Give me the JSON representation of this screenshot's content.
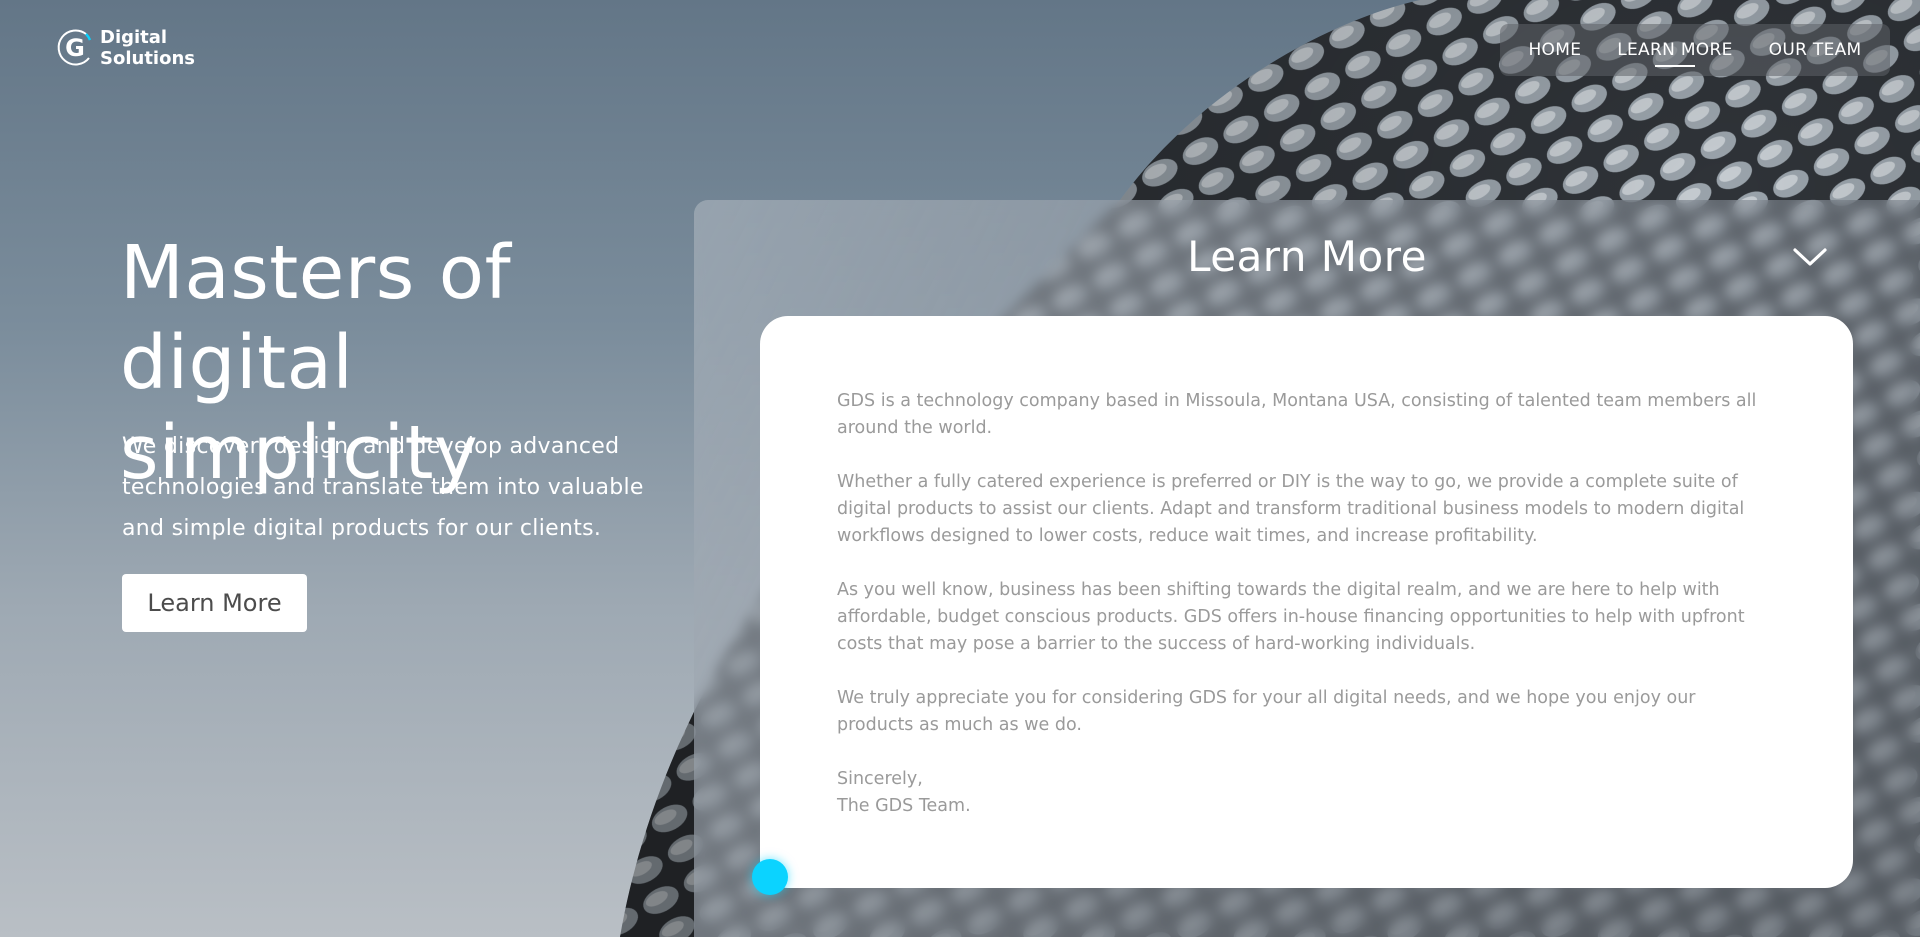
{
  "brand": {
    "logo_letter": "G",
    "line1": "Digital",
    "line2": "Solutions",
    "accent_color": "#0bd3ff"
  },
  "nav": {
    "items": [
      {
        "label": "HOME"
      },
      {
        "label": "LEARN MORE",
        "active": true
      },
      {
        "label": "OUR TEAM"
      }
    ]
  },
  "hero": {
    "title_line1": "Masters of",
    "title_line2": "digital simplicity",
    "subtitle": "We discover, design, and develop advanced technologies and translate them into valuable and simple digital products for our clients.",
    "button_label": "Learn More"
  },
  "panel": {
    "title": "Learn More",
    "toggle_icon": "chevron-down-icon",
    "paragraphs": [
      "GDS is a technology company based in Missoula, Montana USA, consisting of talented team members all around the world.",
      "Whether a fully catered experience is preferred or DIY is the way to go, we provide a complete suite of digital products to assist our clients. Adapt and transform traditional business models to modern digital workflows designed to lower costs, reduce wait times, and increase profitability.",
      "As you well know, business has been shifting towards the digital realm, and we are here to help with affordable, budget conscious products. GDS offers in-house financing opportunities to help with upfront costs that may pose a barrier to the success of hard-working individuals.",
      "We truly appreciate you for considering GDS for your all digital needs, and we hope you enjoy our products as much as we do."
    ],
    "sign_off_1": "Sincerely,",
    "sign_off_2": "The GDS Team."
  }
}
